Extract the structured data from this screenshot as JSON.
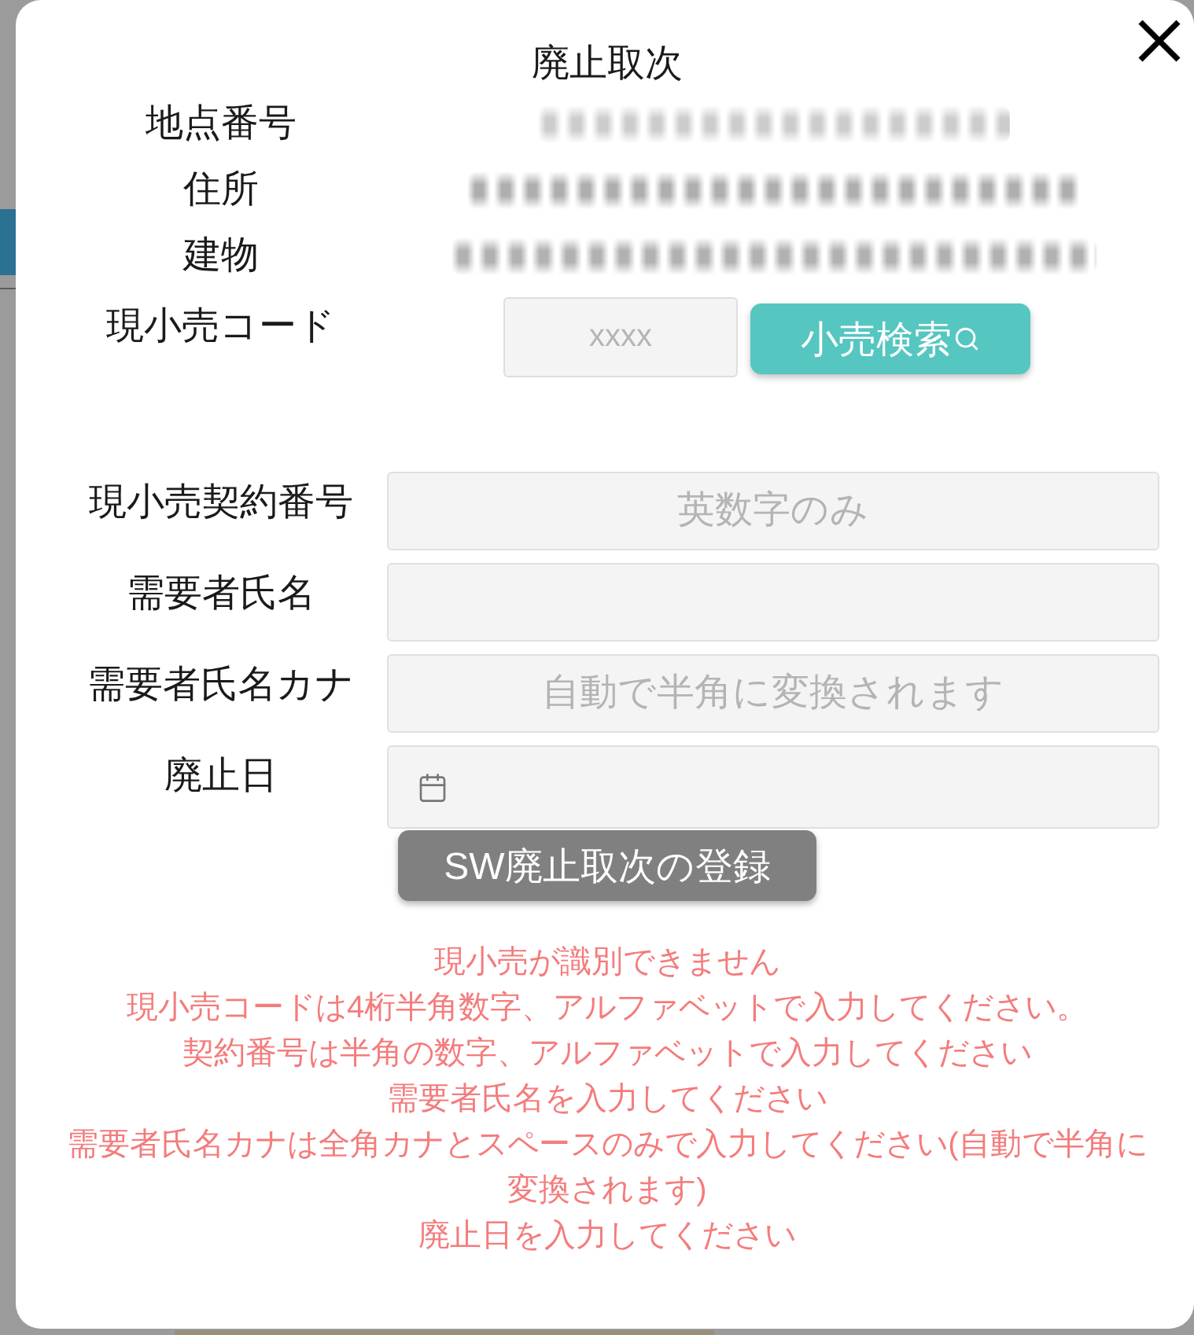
{
  "dialog": {
    "title": "廃止取次"
  },
  "info_rows": [
    {
      "label": "地点番号",
      "value_blurred": true
    },
    {
      "label": "住所",
      "value_blurred": true
    },
    {
      "label": "建物",
      "value_blurred": true
    }
  ],
  "retailer_code": {
    "label": "現小売コード",
    "placeholder": "xxxx",
    "search_button": "小売検索"
  },
  "form_fields": [
    {
      "label": "現小売契約番号",
      "kind": "text",
      "placeholder": "英数字のみ"
    },
    {
      "label": "需要者氏名",
      "kind": "text"
    },
    {
      "label": "需要者氏名カナ",
      "kind": "text",
      "placeholder": "自動で半角に変換されます"
    },
    {
      "label": "廃止日",
      "kind": "date"
    }
  ],
  "submit_button": {
    "label": "SW廃止取次の登録",
    "disabled": true
  },
  "errors": [
    "現小売が識別できません",
    "現小売コードは4桁半角数字、アルファベットで入力してください。",
    "契約番号は半角の数字、アルファベットで入力してください",
    "需要者氏名を入力してください",
    "需要者氏名カナは全角カナとスペースのみで入力してください(自動で半角に変換されます)",
    "廃止日を入力してください"
  ]
}
